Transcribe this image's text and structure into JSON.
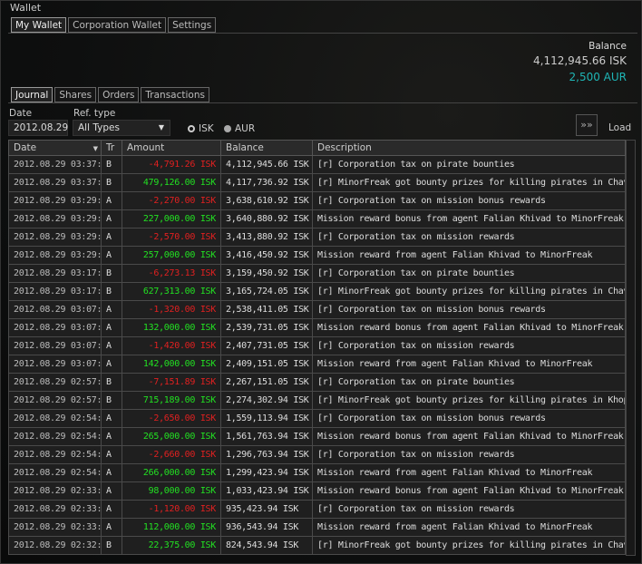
{
  "window": {
    "title": "Wallet"
  },
  "top_tabs": [
    {
      "label": "My Wallet",
      "active": true
    },
    {
      "label": "Corporation Wallet"
    },
    {
      "label": "Settings"
    }
  ],
  "balance": {
    "label": "Balance",
    "isk": "4,112,945.66 ISK",
    "aur": "2,500 AUR",
    "aur_color": "#1fb6b6"
  },
  "sub_tabs": [
    {
      "label": "Journal",
      "active": true
    },
    {
      "label": "Shares"
    },
    {
      "label": "Orders"
    },
    {
      "label": "Transactions"
    }
  ],
  "filters": {
    "date_label": "Date",
    "date_value": "2012.08.29",
    "ref_label": "Ref. type",
    "ref_value": "All Types",
    "isk_label": "ISK",
    "aur_label": "AUR",
    "load_label": "Load"
  },
  "table": {
    "columns": [
      "Date",
      "Tr",
      "Amount",
      "Balance",
      "Description"
    ],
    "rows": [
      [
        "2012.08.29 03:37:",
        "B",
        "-4,791.26 ISK",
        "4,112,945.66 ISK",
        "[r] Corporation tax on pirate bounties"
      ],
      [
        "2012.08.29 03:37:",
        "B",
        "479,126.00 ISK",
        "4,117,736.92 ISK",
        "[r] MinorFreak got bounty prizes for killing pirates in Chaven"
      ],
      [
        "2012.08.29 03:29:",
        "A",
        "-2,270.00 ISK",
        "3,638,610.92 ISK",
        "[r] Corporation tax on mission bonus rewards"
      ],
      [
        "2012.08.29 03:29:",
        "A",
        "227,000.00 ISK",
        "3,640,880.92 ISK",
        "Mission reward bonus from agent Falian Khivad to MinorFreak"
      ],
      [
        "2012.08.29 03:29:",
        "A",
        "-2,570.00 ISK",
        "3,413,880.92 ISK",
        "[r] Corporation tax on mission rewards"
      ],
      [
        "2012.08.29 03:29:",
        "A",
        "257,000.00 ISK",
        "3,416,450.92 ISK",
        "Mission reward from agent Falian Khivad to MinorFreak"
      ],
      [
        "2012.08.29 03:17:",
        "B",
        "-6,273.13 ISK",
        "3,159,450.92 ISK",
        "[r] Corporation tax on pirate bounties"
      ],
      [
        "2012.08.29 03:17:",
        "B",
        "627,313.00 ISK",
        "3,165,724.05 ISK",
        "[r] MinorFreak got bounty prizes for killing pirates in Chaven"
      ],
      [
        "2012.08.29 03:07:",
        "A",
        "-1,320.00 ISK",
        "2,538,411.05 ISK",
        "[r] Corporation tax on mission bonus rewards"
      ],
      [
        "2012.08.29 03:07:",
        "A",
        "132,000.00 ISK",
        "2,539,731.05 ISK",
        "Mission reward bonus from agent Falian Khivad to MinorFreak"
      ],
      [
        "2012.08.29 03:07:",
        "A",
        "-1,420.00 ISK",
        "2,407,731.05 ISK",
        "[r] Corporation tax on mission rewards"
      ],
      [
        "2012.08.29 03:07:",
        "A",
        "142,000.00 ISK",
        "2,409,151.05 ISK",
        "Mission reward from agent Falian Khivad to MinorFreak"
      ],
      [
        "2012.08.29 02:57:",
        "B",
        "-7,151.89 ISK",
        "2,267,151.05 ISK",
        "[r] Corporation tax on pirate bounties"
      ],
      [
        "2012.08.29 02:57:",
        "B",
        "715,189.00 ISK",
        "2,274,302.94 ISK",
        "[r] MinorFreak got bounty prizes for killing pirates in Khopa"
      ],
      [
        "2012.08.29 02:54:",
        "A",
        "-2,650.00 ISK",
        "1,559,113.94 ISK",
        "[r] Corporation tax on mission bonus rewards"
      ],
      [
        "2012.08.29 02:54:",
        "A",
        "265,000.00 ISK",
        "1,561,763.94 ISK",
        "Mission reward bonus from agent Falian Khivad to MinorFreak"
      ],
      [
        "2012.08.29 02:54:",
        "A",
        "-2,660.00 ISK",
        "1,296,763.94 ISK",
        "[r] Corporation tax on mission rewards"
      ],
      [
        "2012.08.29 02:54:",
        "A",
        "266,000.00 ISK",
        "1,299,423.94 ISK",
        "Mission reward from agent Falian Khivad to MinorFreak"
      ],
      [
        "2012.08.29 02:33:",
        "A",
        "98,000.00 ISK",
        "1,033,423.94 ISK",
        "Mission reward bonus from agent Falian Khivad to MinorFreak"
      ],
      [
        "2012.08.29 02:33:",
        "A",
        "-1,120.00 ISK",
        "935,423.94 ISK",
        "[r] Corporation tax on mission rewards"
      ],
      [
        "2012.08.29 02:33:",
        "A",
        "112,000.00 ISK",
        "936,543.94 ISK",
        "Mission reward from agent Falian Khivad to MinorFreak"
      ],
      [
        "2012.08.29 02:32:",
        "B",
        "22,375.00 ISK",
        "824,543.94 ISK",
        "[r] MinorFreak got bounty prizes for killing pirates in Chaven"
      ]
    ]
  }
}
